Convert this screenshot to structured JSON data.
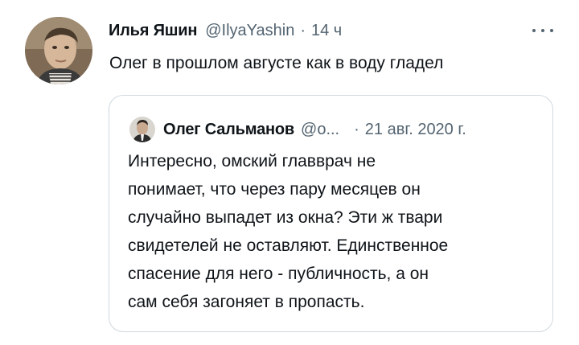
{
  "tweet": {
    "author_name": "Илья Яшин",
    "author_handle": "@IlyaYashin",
    "separator": "·",
    "time": "14 ч",
    "text": "Олег в прошлом августе как в воду гладел"
  },
  "quoted_tweet": {
    "author_name": "Олег Сальманов",
    "author_handle": "@о...",
    "separator": "·",
    "date": "21 авг. 2020 г.",
    "text_lines": [
      "Интересно, омский главврач не",
      "понимает, что через пару месяцев он",
      "случайно выпадет из окна? Эти ж твари",
      "свидетелей не оставляют. Единственное",
      "спасение для него - публичность, а он",
      "сам себя загоняет в пропасть."
    ]
  },
  "icons": {
    "more": "more-horizontal-icon",
    "avatar": "user-avatar",
    "quoted_avatar": "quoted-user-avatar"
  },
  "colors": {
    "text_primary": "#0f1419",
    "text_secondary": "#536471",
    "border": "#cfd9de"
  }
}
